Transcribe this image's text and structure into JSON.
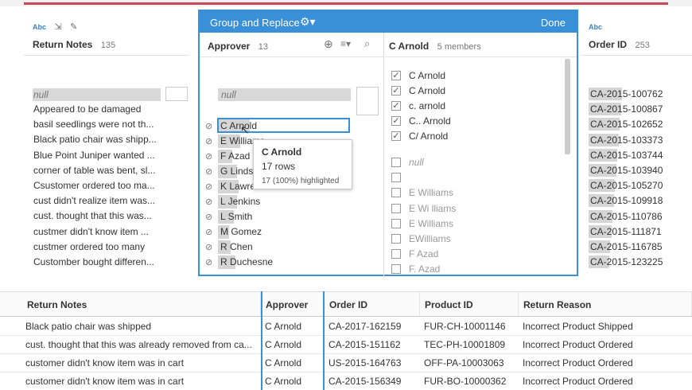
{
  "left_pane": {
    "type_label": "Abc",
    "header": "Return Notes",
    "count": "135",
    "rows": [
      "null",
      "Appeared to be damaged",
      "basil seedlings were not th...",
      "Black patio chair was shipp...",
      "Blue Point Juniper wanted ...",
      "corner of table was bent, sl...",
      "Csustomer ordered too ma...",
      "cust didn't realize item was...",
      "cust. thought that this was...",
      "custmer didn't know item ...",
      "custmer ordered too many",
      "Customber bought differen..."
    ]
  },
  "group_dialog": {
    "title": "Group and Replace",
    "done": "Done",
    "left": {
      "header": "Approver",
      "count": "13",
      "null_label": "null",
      "rows": [
        "C Arnold",
        "E Williams",
        "F Azad",
        "G Linds",
        "K Lawre",
        "L Jenkins",
        "L Smith",
        "M Gomez",
        "R Chen",
        "R Duchesne"
      ]
    },
    "right": {
      "header": "C Arnold",
      "count": "5 members",
      "members": [
        {
          "label": "C  Arnold",
          "checked": true
        },
        {
          "label": "C Arnold",
          "checked": true
        },
        {
          "label": "c. arnold",
          "checked": true
        },
        {
          "label": "C.. Arnold",
          "checked": true
        },
        {
          "label": "C/ Arnold",
          "checked": true
        },
        {
          "label": "null",
          "checked": false
        },
        {
          "label": "",
          "checked": false
        },
        {
          "label": "E  Williams",
          "checked": false
        },
        {
          "label": "E Wi lliams",
          "checked": false
        },
        {
          "label": "E Williams",
          "checked": false
        },
        {
          "label": "EWilliams",
          "checked": false
        },
        {
          "label": "F Azad",
          "checked": false
        },
        {
          "label": "F. Azad",
          "checked": false
        }
      ]
    }
  },
  "tooltip": {
    "name": "C Arnold",
    "rows": "17 rows",
    "highlighted": "17 (100%) highlighted"
  },
  "right_pane": {
    "type_label": "Abc",
    "header": "Order ID",
    "count": "253",
    "rows": [
      "CA-2015-100762",
      "CA-2015-100867",
      "CA-2015-102652",
      "CA-2015-103373",
      "CA-2015-103744",
      "CA-2015-103940",
      "CA-2015-105270",
      "CA-2015-109918",
      "CA-2015-110786",
      "CA-2015-111871",
      "CA-2015-116785",
      "CA-2015-123225"
    ]
  },
  "grid": {
    "headers": [
      "Return Notes",
      "Approver",
      "Order ID",
      "Product ID",
      "Return Reason"
    ],
    "rows": [
      [
        "Black patio chair was shipped",
        "C Arnold",
        "CA-2017-162159",
        "FUR-CH-10001146",
        "Incorrect Product Shipped"
      ],
      [
        "cust. thought that this was already removed from ca...",
        "C Arnold",
        "CA-2015-151162",
        "TEC-PH-10001809",
        "Incorrect Product Ordered"
      ],
      [
        "customer didn't know item was in cart",
        "C Arnold",
        "US-2015-164763",
        "OFF-PA-10003063",
        "Incorrect Product Ordered"
      ],
      [
        "customer didn't know item was in cart",
        "C Arnold",
        "CA-2015-156349",
        "FUR-BO-10000362",
        "Incorrect Product Ordered"
      ]
    ]
  },
  "colors": {
    "accent": "#3a8fd9",
    "top_stripe": "#c8485a"
  }
}
